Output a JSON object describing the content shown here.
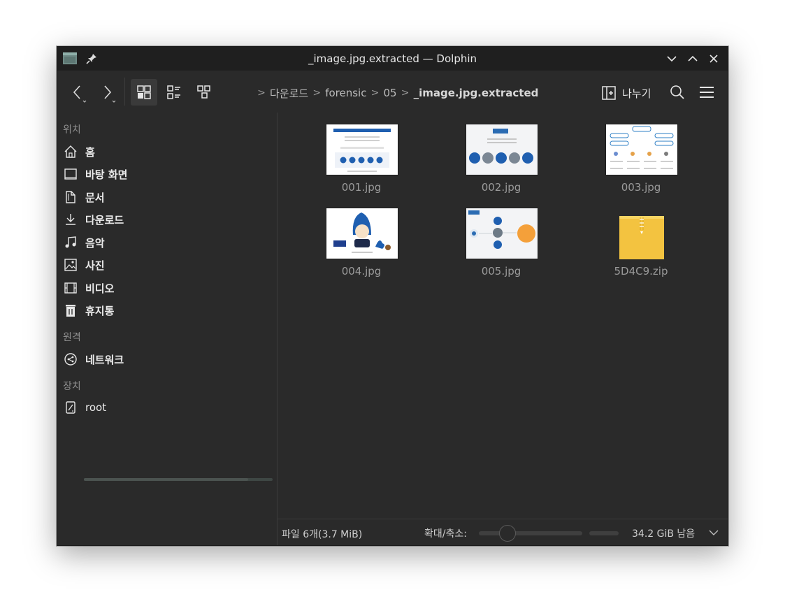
{
  "window": {
    "title": "_image.jpg.extracted — Dolphin"
  },
  "toolbar": {
    "back_icon": "chevron-left-icon",
    "forward_icon": "chevron-right-icon",
    "breadcrumb": [
      "다운로드",
      "forensic",
      "05",
      "_image.jpg.extracted"
    ],
    "split_label": "나누기",
    "search_icon": "search-icon",
    "menu_icon": "hamburger-menu-icon"
  },
  "sidebar": {
    "places_header": "위치",
    "places": [
      {
        "label": "홈",
        "icon": "home-icon"
      },
      {
        "label": "바탕 화면",
        "icon": "desktop-icon"
      },
      {
        "label": "문서",
        "icon": "documents-icon"
      },
      {
        "label": "다운로드",
        "icon": "download-icon"
      },
      {
        "label": "음악",
        "icon": "music-icon"
      },
      {
        "label": "사진",
        "icon": "pictures-icon"
      },
      {
        "label": "비디오",
        "icon": "video-icon"
      },
      {
        "label": "휴지통",
        "icon": "trash-icon"
      }
    ],
    "remote_header": "원격",
    "remote": [
      {
        "label": "네트워크",
        "icon": "network-icon"
      }
    ],
    "devices_header": "장치",
    "devices": [
      {
        "label": "root",
        "icon": "drive-icon",
        "usage": 0.87
      }
    ]
  },
  "files": [
    {
      "name": "001.jpg",
      "type": "image"
    },
    {
      "name": "002.jpg",
      "type": "image"
    },
    {
      "name": "003.jpg",
      "type": "image"
    },
    {
      "name": "004.jpg",
      "type": "image"
    },
    {
      "name": "005.jpg",
      "type": "image"
    },
    {
      "name": "5D4C9.zip",
      "type": "zip"
    }
  ],
  "status": {
    "summary": "파일 6개(3.7 MiB)",
    "zoom_label": "확대/축소:",
    "zoom_level": 0.27,
    "free_space": "34.2 GiB 남음"
  },
  "colors": {
    "window_bg": "#2a2a2a",
    "titlebar_bg": "#1f1f1f",
    "text": "#e6e6e6",
    "muted": "#9a9a9a",
    "zip_yellow": "#f3c340"
  }
}
